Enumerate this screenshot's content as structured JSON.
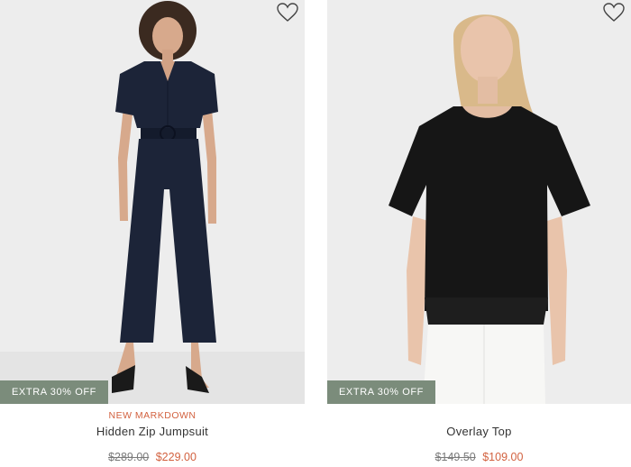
{
  "products": [
    {
      "badge": "EXTRA 30% OFF",
      "tag": "NEW MARKDOWN",
      "name": "Hidden Zip Jumpsuit",
      "original_price": "$289.00",
      "sale_price": "$229.00",
      "wishlist_icon": "heart-outline-icon"
    },
    {
      "badge": "EXTRA 30% OFF",
      "tag": "",
      "name": "Overlay Top",
      "original_price": "$149.50",
      "sale_price": "$109.00",
      "wishlist_icon": "heart-outline-icon"
    }
  ],
  "colors": {
    "badge_bg": "#7b8c7b",
    "sale_price": "#d2613f",
    "tag": "#d2613f",
    "photo_bg": "#ededed"
  }
}
